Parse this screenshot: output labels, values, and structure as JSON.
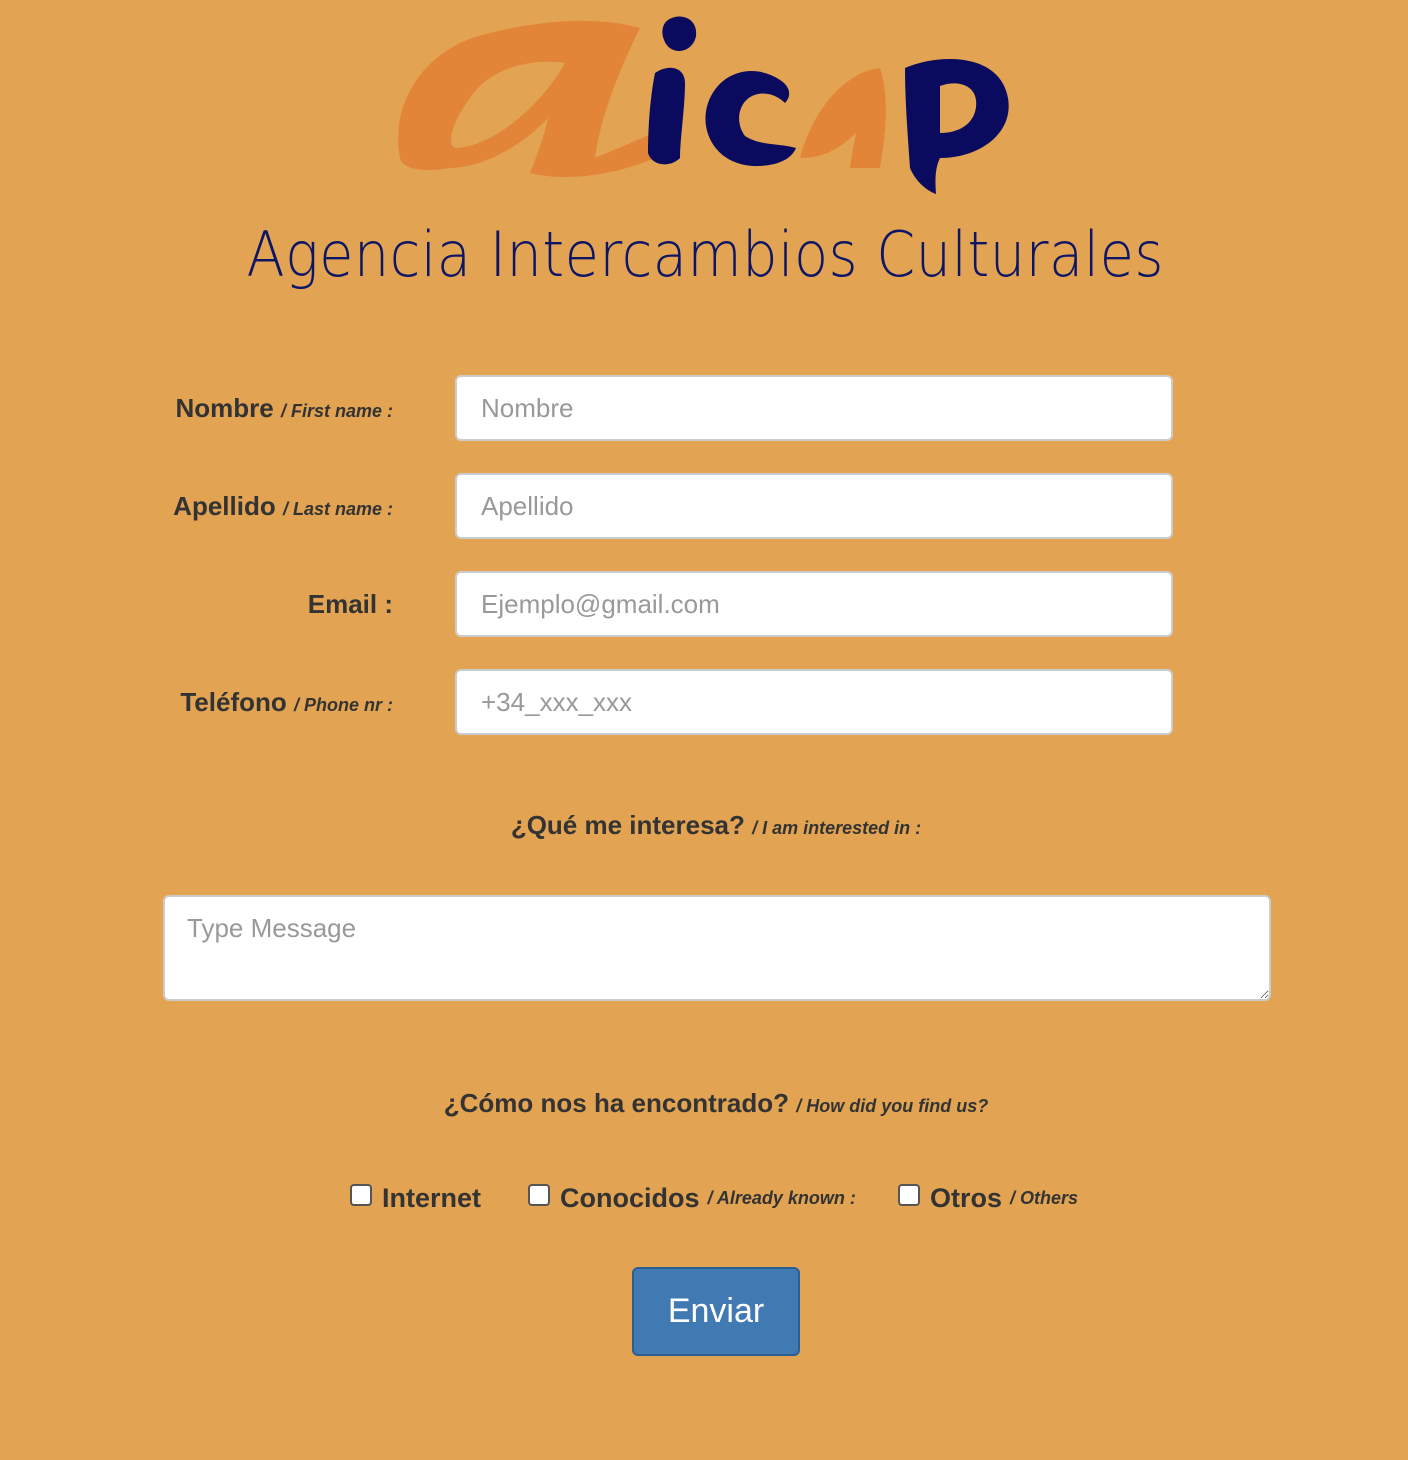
{
  "brand": {
    "logo_text": "aicap",
    "subtitle": "Agencia Intercambios Culturales",
    "colors": {
      "logo_orange": "#e38538",
      "logo_navy": "#0a0a5e",
      "background": "#e2a352"
    }
  },
  "form": {
    "fields": [
      {
        "label": "Nombre",
        "label_en": "/ First name :",
        "placeholder": "Nombre"
      },
      {
        "label": "Apellido",
        "label_en": "/ Last name :",
        "placeholder": "Apellido"
      },
      {
        "label": "Email :",
        "label_en": "",
        "placeholder": "Ejemplo@gmail.com"
      },
      {
        "label": "Teléfono",
        "label_en": "/ Phone nr :",
        "placeholder": "+34_xxx_xxx"
      }
    ],
    "interest": {
      "title": "¿Qué me interesa?",
      "title_en": "/ I am interested in :",
      "placeholder": "Type Message"
    },
    "found_us": {
      "title": "¿Cómo nos ha encontrado?",
      "title_en": "/ How did you find us?",
      "options": [
        {
          "label": "Internet",
          "label_en": "",
          "checked": false
        },
        {
          "label": "Conocidos",
          "label_en": "/ Already known :",
          "checked": false
        },
        {
          "label": "Otros",
          "label_en": "/ Others",
          "checked": false
        }
      ]
    },
    "submit_label": "Enviar",
    "submit_color": "#4179b3"
  }
}
